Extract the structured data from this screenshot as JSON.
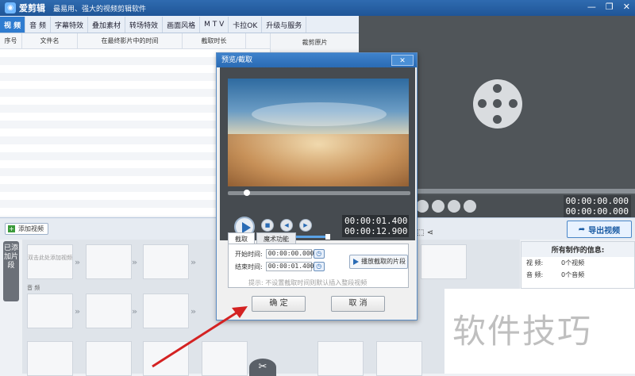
{
  "app": {
    "name": "爱剪辑",
    "subtitle": "最易用、强大的视频剪辑软件"
  },
  "tabs": [
    "视 频",
    "音 频",
    "字幕特效",
    "叠加素材",
    "转场特效",
    "画面风格",
    "M T V",
    "卡拉OK",
    "升级与服务"
  ],
  "clip_list": {
    "columns": [
      "序号",
      "文件名",
      "在最终影片中的时间",
      "截取时长"
    ],
    "side_title": "裁剪原片"
  },
  "main_preview": {
    "time_current": "00:00:00.000",
    "time_total": "00:00:00.000",
    "export_label": "导出视频"
  },
  "toolbar": {
    "add_video_label": "添加视频"
  },
  "timeline": {
    "vertical_tab": "已添加片段",
    "first_slot_text": "双击此处添加视频",
    "audio_label": "音 频"
  },
  "info": {
    "title": "所有制作的信息:",
    "rows": [
      {
        "k": "视 频:",
        "v": "0个视频"
      },
      {
        "k": "音 频:",
        "v": "0个音频"
      }
    ]
  },
  "watermark": "软件技巧",
  "dialog": {
    "title": "预览/截取",
    "close": "✕",
    "time_current": "00:00:01.400",
    "time_total": "00:00:12.900",
    "tab_crop": "截取",
    "tab_magic": "魔术功能",
    "start_label": "开始时间:",
    "start_value": "00:00:00.000",
    "end_label": "结束时间:",
    "end_value": "00:00:01.400",
    "play_segment": "播放截取的片段",
    "hint": "提示: 不设置截取时间则默认插入整段视频",
    "ok": "确 定",
    "cancel": "取 消"
  }
}
